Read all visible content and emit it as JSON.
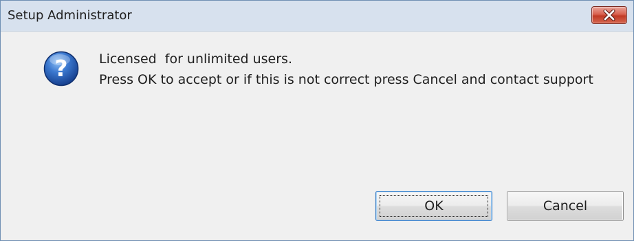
{
  "window": {
    "title": "Setup Administrator",
    "close_icon": "close-icon"
  },
  "message": {
    "icon": "question-icon",
    "line1": "Licensed  for unlimited users.",
    "line2": "Press OK to accept or if this is not correct press Cancel and contact support"
  },
  "buttons": {
    "ok_label": "OK",
    "cancel_label": "Cancel"
  },
  "colors": {
    "titlebar": "#d7e1ee",
    "close_button": "#c13a25",
    "icon_blue": "#2a5fb3",
    "default_button_border": "#2f75c2"
  }
}
